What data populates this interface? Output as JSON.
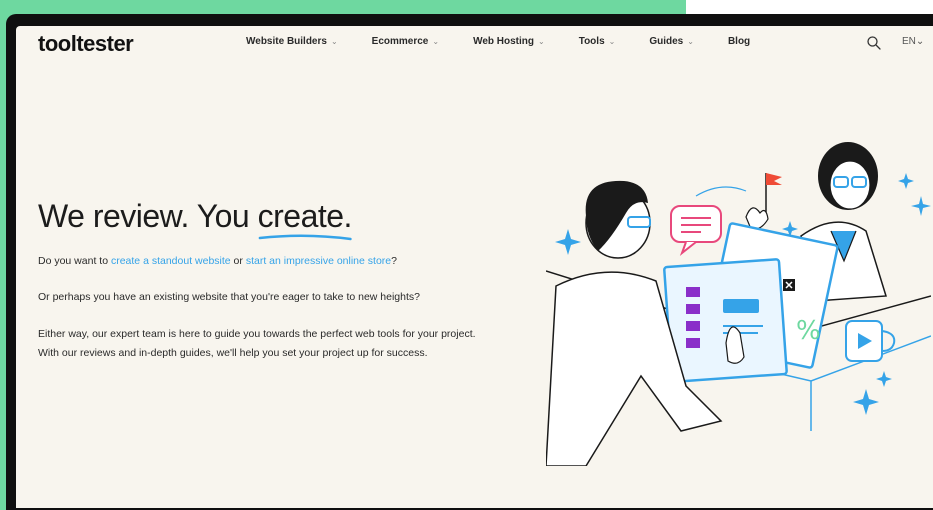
{
  "logo": "tooltester",
  "nav": [
    {
      "label": "Website Builders",
      "dropdown": true
    },
    {
      "label": "Ecommerce",
      "dropdown": true
    },
    {
      "label": "Web Hosting",
      "dropdown": true
    },
    {
      "label": "Tools",
      "dropdown": true
    },
    {
      "label": "Guides",
      "dropdown": true
    },
    {
      "label": "Blog",
      "dropdown": false
    }
  ],
  "language": "EN",
  "hero": {
    "title_start": "We review. You ",
    "title_accent": "create.",
    "p1_before": "Do you want to ",
    "p1_link1": "create a standout website",
    "p1_middle": " or ",
    "p1_link2": "start an impressive online store",
    "p1_after": "?",
    "p2": "Or perhaps you have an existing website that you're eager to take to new heights?",
    "p3": "Either way, our expert team is here to guide you towards the perfect web tools for your project. With our reviews and in-depth guides, we'll help you set your project up for success."
  },
  "illustration": {
    "card_text": "%"
  },
  "colors": {
    "accent": "#35a3e8",
    "purple": "#8a2fc9",
    "pink": "#e8487c",
    "flag": "#ef4b36",
    "frame_bg": "#6ed8a0"
  }
}
